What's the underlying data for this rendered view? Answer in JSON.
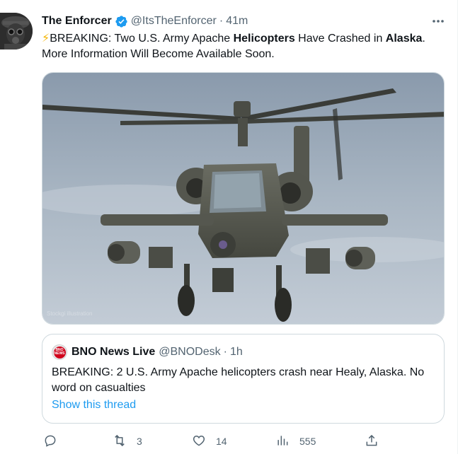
{
  "tweet": {
    "display_name": "The Enforcer",
    "handle": "@ItsTheEnforcer",
    "separator": "·",
    "time": "41m",
    "text_parts": {
      "bolt": "⚡",
      "p1": "BREAKING: Two U.S. Army Apache ",
      "b1": "Helicopters",
      "p2": " Have Crashed in ",
      "b2": "Alaska",
      "p3": ". More Information Will Become Available Soon."
    },
    "media_watermark": "Stockgi illustration"
  },
  "quote": {
    "avatar_line1": "BNO",
    "avatar_line2": "NEWS",
    "display_name": "BNO News Live",
    "handle": "@BNODesk",
    "separator": "·",
    "time": "1h",
    "text": "BREAKING: 2 U.S. Army Apache helicopters crash near Healy, Alaska. No word on casualties",
    "thread_link": "Show this thread"
  },
  "actions": {
    "reply_count": "",
    "retweet_count": "3",
    "like_count": "14",
    "views_count": "555"
  },
  "colors": {
    "accent": "#1d9bf0",
    "secondary_text": "#536471",
    "border": "#cfd9de",
    "bno_red": "#d0021b"
  },
  "icons": [
    "verified-badge-icon",
    "more-icon",
    "reply-icon",
    "retweet-icon",
    "like-icon",
    "views-icon",
    "share-icon"
  ]
}
